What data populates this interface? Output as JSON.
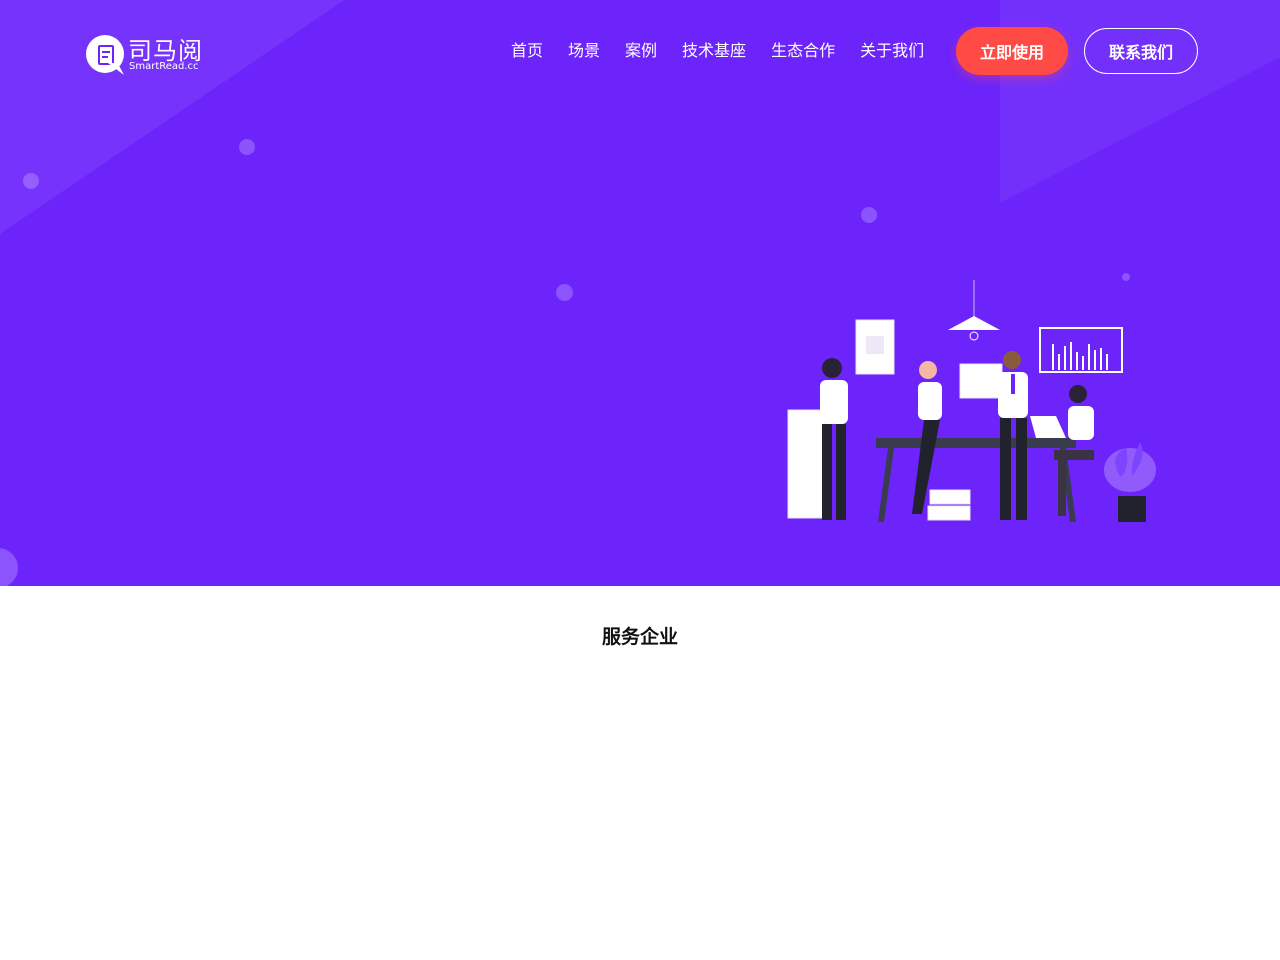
{
  "brand": {
    "name": "司马阅",
    "subtitle": "SmartRead.cc"
  },
  "nav": {
    "links": [
      "首页",
      "场景",
      "案例",
      "技术基座",
      "生态合作",
      "关于我们"
    ],
    "cta_primary": "立即使用",
    "cta_secondary": "联系我们"
  },
  "hero": {
    "background_color": "#6c24fb",
    "illustration_icon": "team-office-illustration"
  },
  "section": {
    "title": "服务企业"
  },
  "colors": {
    "brand": "#6c24fb",
    "accent": "#ff4a45",
    "text_dark": "#111111"
  }
}
